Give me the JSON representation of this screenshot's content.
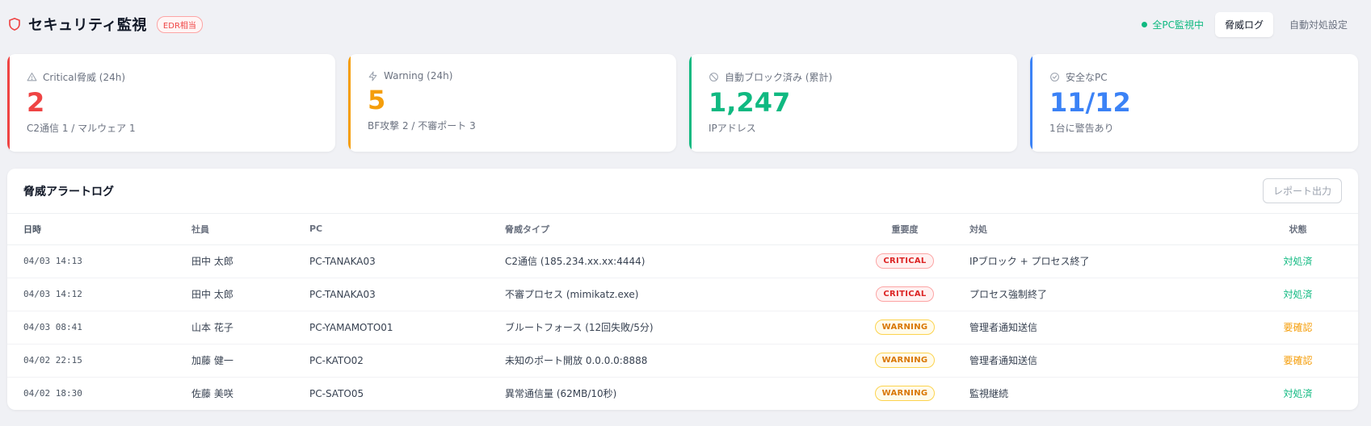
{
  "header": {
    "title": "セキュリティ監視",
    "badge": "EDR相当",
    "status": "全PC監視中",
    "tabs": [
      {
        "label": "脅威ログ",
        "active": true
      },
      {
        "label": "自動対処設定",
        "active": false
      }
    ]
  },
  "kpis": [
    {
      "label": "Critical脅威 (24h)",
      "value": "2",
      "sub": "C2通信 1 / マルウェア 1",
      "color": "#ef4444",
      "icon": "alert-triangle-icon"
    },
    {
      "label": "Warning (24h)",
      "value": "5",
      "sub": "BF攻撃 2 / 不審ポート 3",
      "color": "#f59e0b",
      "icon": "bolt-icon"
    },
    {
      "label": "自動ブロック済み (累計)",
      "value": "1,247",
      "sub": "IPアドレス",
      "color": "#10b981",
      "icon": "block-icon"
    },
    {
      "label": "安全なPC",
      "value": "11/12",
      "sub": "1台に警告あり",
      "color": "#3b82f6",
      "icon": "check-circle-icon"
    }
  ],
  "log": {
    "title": "脅威アラートログ",
    "report_button": "レポート出力",
    "columns": [
      "日時",
      "社員",
      "PC",
      "脅威タイプ",
      "重要度",
      "対処",
      "状態"
    ],
    "rows": [
      {
        "time": "04/03 14:13",
        "employee": "田中 太郎",
        "pc": "PC-TANAKA03",
        "type": "C2通信 (185.234.xx.xx:4444)",
        "severity": "CRITICAL",
        "action": "IPブロック + プロセス終了",
        "status": "対処済"
      },
      {
        "time": "04/03 14:12",
        "employee": "田中 太郎",
        "pc": "PC-TANAKA03",
        "type": "不審プロセス (mimikatz.exe)",
        "severity": "CRITICAL",
        "action": "プロセス強制終了",
        "status": "対処済"
      },
      {
        "time": "04/03 08:41",
        "employee": "山本 花子",
        "pc": "PC-YAMAMOTO01",
        "type": "ブルートフォース (12回失敗/5分)",
        "severity": "WARNING",
        "action": "管理者通知送信",
        "status": "要確認"
      },
      {
        "time": "04/02 22:15",
        "employee": "加藤 健一",
        "pc": "PC-KATO02",
        "type": "未知のポート開放 0.0.0.0:8888",
        "severity": "WARNING",
        "action": "管理者通知送信",
        "status": "要確認"
      },
      {
        "time": "04/02 18:30",
        "employee": "佐藤 美咲",
        "pc": "PC-SATO05",
        "type": "異常通信量 (62MB/10秒)",
        "severity": "WARNING",
        "action": "監視継続",
        "status": "対処済"
      }
    ]
  },
  "colors": {
    "critical": "#ef4444",
    "warning": "#f59e0b",
    "success": "#10b981",
    "info": "#3b82f6"
  }
}
